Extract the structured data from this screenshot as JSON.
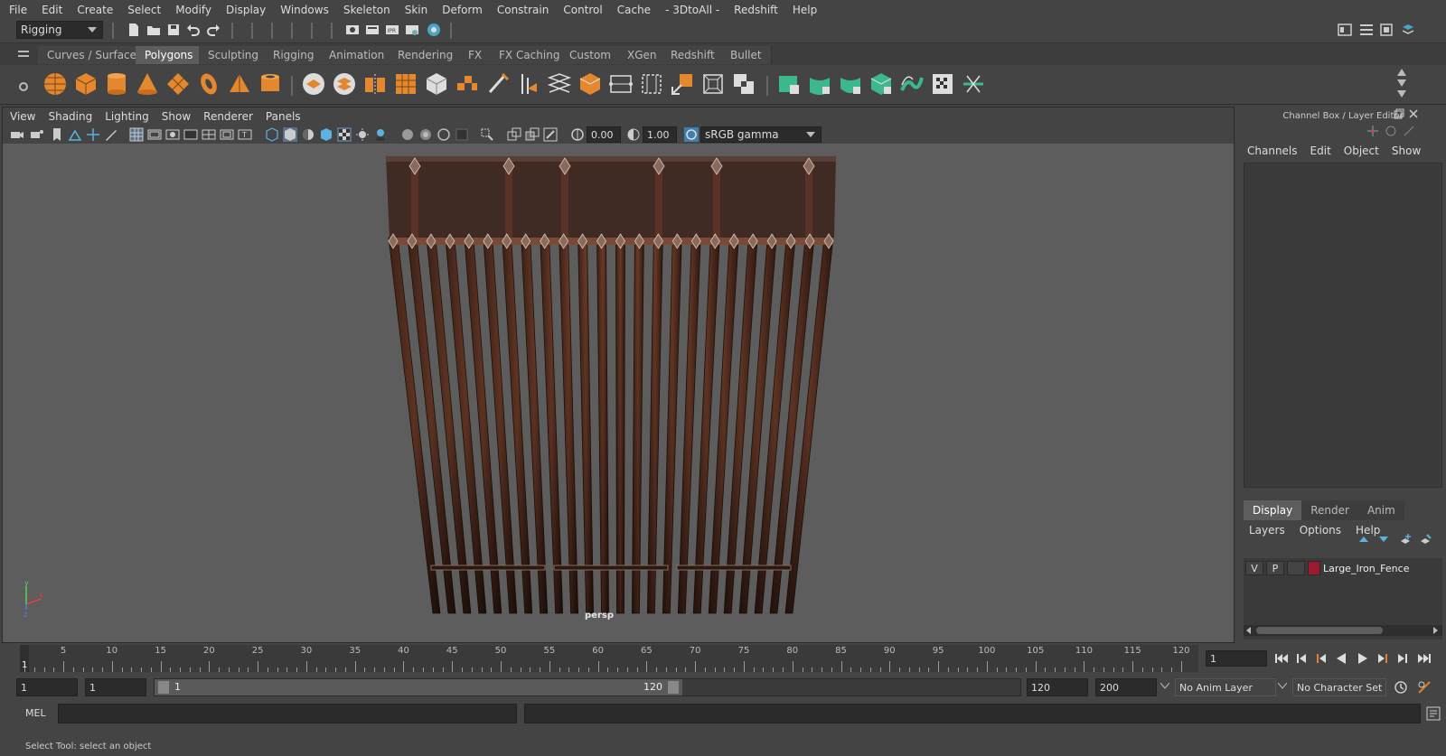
{
  "menubar": {
    "items": [
      "File",
      "Edit",
      "Create",
      "Select",
      "Modify",
      "Display",
      "Windows",
      "Skeleton",
      "Skin",
      "Deform",
      "Constrain",
      "Control",
      "Cache",
      "- 3DtoAll -",
      "Redshift",
      "Help"
    ]
  },
  "statusline": {
    "mode": "Rigging"
  },
  "shelf": {
    "tabs": [
      "Curves / Surfaces",
      "Polygons",
      "Sculpting",
      "Rigging",
      "Animation",
      "Rendering",
      "FX",
      "FX Caching",
      "Custom",
      "XGen",
      "Redshift",
      "Bullet"
    ],
    "active_tab": "Polygons"
  },
  "viewport": {
    "menu": [
      "View",
      "Shading",
      "Lighting",
      "Show",
      "Renderer",
      "Panels"
    ],
    "exposure": "0.00",
    "gamma": "1.00",
    "colorspace": "sRGB gamma",
    "camera_label": "persp",
    "axis_labels": {
      "y": "y",
      "x": "x",
      "z": "z"
    }
  },
  "channelbox": {
    "title": "Channel Box / Layer Editor",
    "menu": [
      "Channels",
      "Edit",
      "Object",
      "Show"
    ],
    "layer_tabs": [
      "Display",
      "Render",
      "Anim"
    ],
    "active_layer_tab": "Display",
    "layer_menu": [
      "Layers",
      "Options",
      "Help"
    ],
    "layers": [
      {
        "v": "V",
        "p": "P",
        "name": "Large_Iron_Fence",
        "color": "#9a1a2e"
      }
    ]
  },
  "timeline": {
    "ticks": [
      1,
      5,
      10,
      15,
      20,
      25,
      30,
      35,
      40,
      45,
      50,
      55,
      60,
      65,
      70,
      75,
      80,
      85,
      90,
      95,
      100,
      105,
      110,
      115,
      120
    ],
    "current_frame": "1",
    "current_frame_marker": "1"
  },
  "range": {
    "start": "1",
    "playback_start": "1",
    "slider_start": "1",
    "slider_end": "120",
    "playback_end": "120",
    "end": "200",
    "anim_layer": "No Anim Layer",
    "character_set": "No Character Set"
  },
  "command": {
    "label": "MEL"
  },
  "helpline": {
    "text": "Select Tool: select an object"
  }
}
